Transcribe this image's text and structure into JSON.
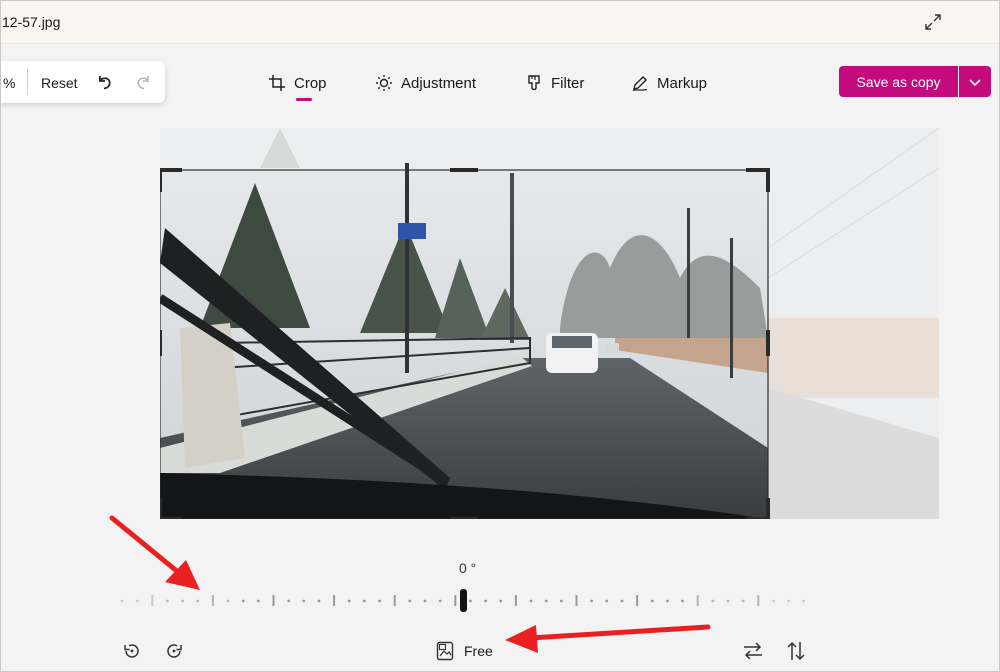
{
  "window": {
    "title": "12-57.jpg",
    "expand_icon": "expand-icon"
  },
  "left_toolbar": {
    "zoom_suffix": "%",
    "reset_label": "Reset",
    "undo_icon": "undo-icon",
    "redo_icon": "redo-icon"
  },
  "tabs": [
    {
      "label": "Crop",
      "icon": "crop-icon",
      "active": true
    },
    {
      "label": "Adjustment",
      "icon": "brightness-icon",
      "active": false
    },
    {
      "label": "Filter",
      "icon": "filter-icon",
      "active": false
    },
    {
      "label": "Markup",
      "icon": "markup-pen-icon",
      "active": false
    }
  ],
  "save": {
    "label": "Save as copy",
    "dropdown_icon": "chevron-down-icon"
  },
  "straighten": {
    "angle_label": "0 °"
  },
  "bottom": {
    "aspect_label": "Free",
    "aspect_icon": "aspect-ratio-icon"
  },
  "colors": {
    "accent": "#c30b7e",
    "annotation_arrow": "#e8201f",
    "background": "#f3f3f3"
  }
}
